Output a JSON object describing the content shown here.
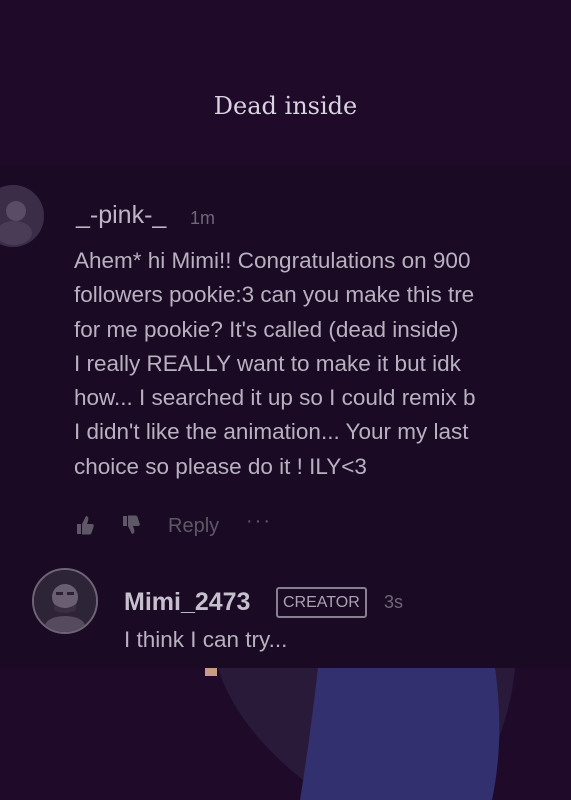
{
  "page": {
    "title": "Dead inside"
  },
  "comment": {
    "username": "_-pink-_",
    "time": "1m",
    "text": "Ahem* hi Mimi!! Congratulations on 900\nfollowers pookie:3 can you make this tre\nfor me pookie? It's called (dead inside)\nI really REALLY want to make it but idk\nhow... I searched it up so I could remix b\nI didn't like the animation... Your my last\nchoice so please do it ! ILY<3",
    "actions": {
      "reply_label": "Reply",
      "more_label": "···"
    }
  },
  "reply": {
    "username": "Mimi_2473",
    "badge": "CREATOR",
    "time": "3s",
    "text": "I think I can try..."
  },
  "colors": {
    "background": "#1f0a2a",
    "text": "#b8b1bf",
    "muted": "#6e6776",
    "figure_shirt": "#32306e"
  }
}
